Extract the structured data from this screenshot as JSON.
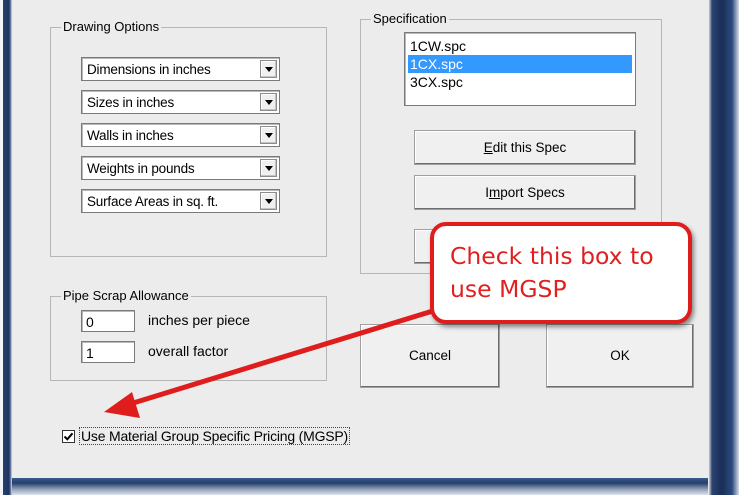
{
  "drawing_options": {
    "title": "Drawing Options",
    "dropdowns": [
      {
        "value": "Dimensions in inches"
      },
      {
        "value": "Sizes in inches"
      },
      {
        "value": "Walls in inches"
      },
      {
        "value": "Weights in pounds"
      },
      {
        "value": "Surface Areas in sq. ft."
      }
    ]
  },
  "specification": {
    "title": "Specification",
    "items": [
      "1CW.spc",
      "1CX.spc",
      "3CX.spc"
    ],
    "selected_index": 1,
    "edit_button": {
      "mnemonic": "E",
      "rest": "dit this Spec"
    },
    "import_button": {
      "before": "I",
      "mnemonic": "m",
      "rest": "port Specs"
    }
  },
  "pipe_scrap": {
    "title": "Pipe Scrap Allowance",
    "inches_value": "0",
    "inches_label": "inches per piece",
    "factor_value": "1",
    "factor_label": "overall factor"
  },
  "buttons": {
    "cancel": "Cancel",
    "ok": "OK"
  },
  "mgsp_checkbox": {
    "label": "Use Material Group Specific Pricing (MGSP)",
    "checked": true
  },
  "callout": {
    "line1": "Check this box to",
    "line2": "use MGSP",
    "color": "#e01d1d"
  }
}
